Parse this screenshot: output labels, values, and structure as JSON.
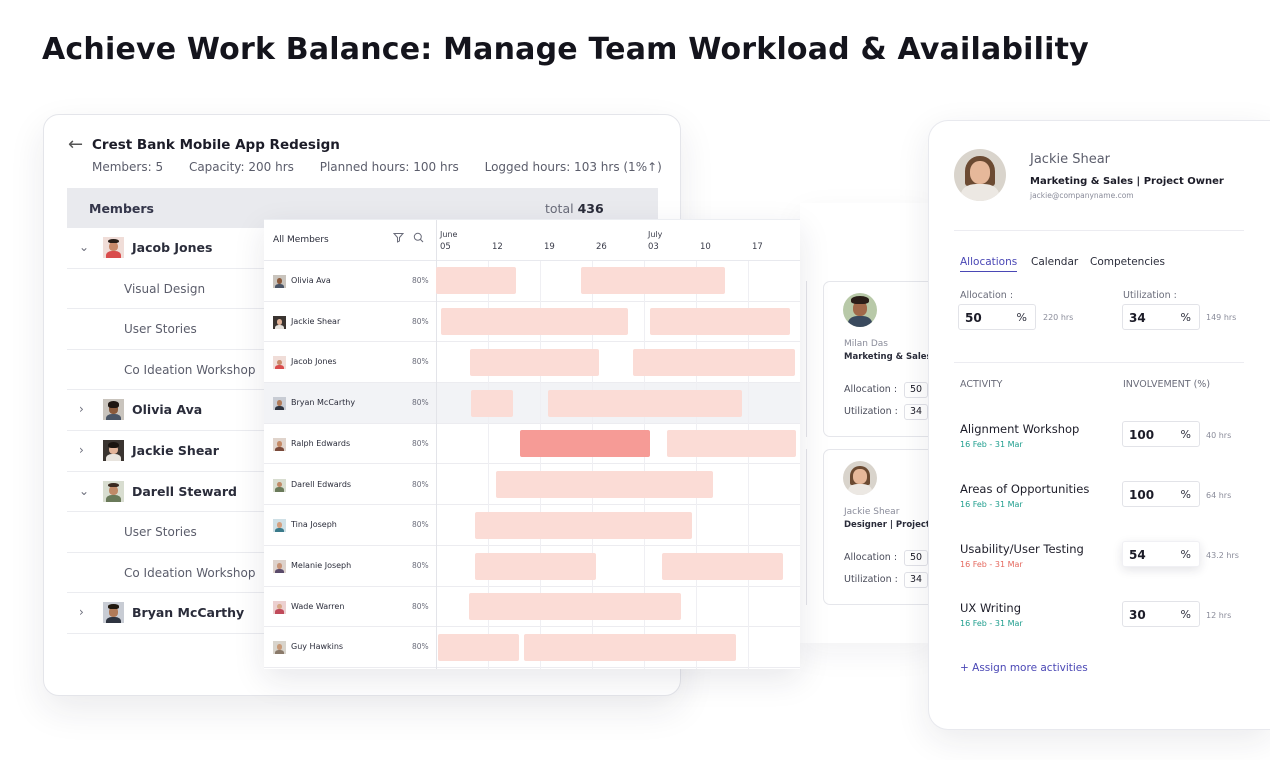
{
  "headline": "Achieve Work Balance: Manage Team Workload & Availability",
  "project": {
    "back_glyph": "←",
    "title": "Crest Bank Mobile App Redesign",
    "stats": [
      "Members: 5",
      "Capacity: 200 hrs",
      "Planned hours: 100 hrs",
      "Logged hours: 103 hrs  (1%↑)"
    ],
    "members_label": "Members",
    "total_label": "total",
    "total_value": "436",
    "tree": [
      {
        "type": "member",
        "name": "Jacob Jones",
        "expanded": true,
        "chevron": "⌄"
      },
      {
        "type": "sub",
        "name": "Visual Design"
      },
      {
        "type": "sub",
        "name": "User Stories"
      },
      {
        "type": "sub",
        "name": "Co Ideation Workshop"
      },
      {
        "type": "member",
        "name": "Olivia Ava",
        "expanded": false,
        "chevron": "›"
      },
      {
        "type": "member",
        "name": "Jackie Shear",
        "expanded": false,
        "chevron": "›"
      },
      {
        "type": "member",
        "name": "Darell Steward",
        "expanded": true,
        "chevron": "⌄"
      },
      {
        "type": "sub",
        "name": "User Stories"
      },
      {
        "type": "sub",
        "name": "Co Ideation Workshop"
      },
      {
        "type": "member",
        "name": "Bryan McCarthy",
        "expanded": false,
        "chevron": "›"
      }
    ]
  },
  "timeline": {
    "all_members": "All Members",
    "filter_icon": "filter-icon",
    "search_icon": "search-icon",
    "months": [
      {
        "label": "June",
        "at": "05"
      },
      {
        "label": "July",
        "at": "03"
      }
    ],
    "dates": [
      "05",
      "12",
      "19",
      "26",
      "03",
      "10",
      "17"
    ],
    "rows": [
      {
        "name": "Olivia Ava",
        "pct": "80%"
      },
      {
        "name": "Jackie Shear",
        "pct": "80%"
      },
      {
        "name": "Jacob Jones",
        "pct": "80%"
      },
      {
        "name": "Bryan McCarthy",
        "pct": "80%",
        "highlight": true
      },
      {
        "name": "Ralph Edwards",
        "pct": "80%"
      },
      {
        "name": "Darell Edwards",
        "pct": "80%"
      },
      {
        "name": "Tina Joseph",
        "pct": "80%"
      },
      {
        "name": "Melanie Joseph",
        "pct": "80%"
      },
      {
        "name": "Wade Warren",
        "pct": "80%"
      },
      {
        "name": "Guy Hawkins",
        "pct": "80%"
      }
    ]
  },
  "mini_cards": [
    {
      "name": "Milan Das",
      "role": "Marketing & Sales |",
      "alloc_label": "Allocation :",
      "alloc": "50",
      "util_label": "Utilization :",
      "util": "34"
    },
    {
      "name": "Jackie Shear",
      "role": "Designer | Project V",
      "alloc_label": "Allocation :",
      "alloc": "50",
      "util_label": "Utilization :",
      "util": "34"
    }
  ],
  "profile": {
    "name": "Jackie Shear",
    "role": "Marketing & Sales | Project Owner",
    "email": "jackie@companyname.com",
    "tabs": [
      "Allocations",
      "Calendar",
      "Competencies"
    ],
    "active_tab": "Allocations",
    "allocation_label": "Allocation :",
    "allocation_value": "50",
    "allocation_hours": "220 hrs",
    "utilization_label": "Utilization :",
    "utilization_value": "34",
    "utilization_hours": "149 hrs",
    "percent": "%",
    "activity_header": "ACTIVITY",
    "involvement_header": "INVOLVEMENT  (%)",
    "activities": [
      {
        "name": "Alignment Workshop",
        "dates": "16 Feb - 31 Mar",
        "date_color": "#1f9e8e",
        "value": "100",
        "hours": "40 hrs"
      },
      {
        "name": "Areas of Opportunities",
        "dates": "16 Feb - 31 Mar",
        "date_color": "#1f9e8e",
        "value": "100",
        "hours": "64 hrs"
      },
      {
        "name": "Usability/User Testing",
        "dates": "16 Feb - 31 Mar",
        "date_color": "#e5695f",
        "value": "54",
        "hours": "43.2 hrs"
      },
      {
        "name": "UX Writing",
        "dates": "16 Feb - 31 Mar",
        "date_color": "#1f9e8e",
        "value": "30",
        "hours": "12 hrs"
      }
    ],
    "assign_link": "+ Assign more activities"
  },
  "colors": {
    "accent": "#4a47b5",
    "bar_light": "#fbdcd6",
    "bar_strong": "#f69b96",
    "date_ok": "#1f9e8e",
    "date_warn": "#e5695f"
  }
}
